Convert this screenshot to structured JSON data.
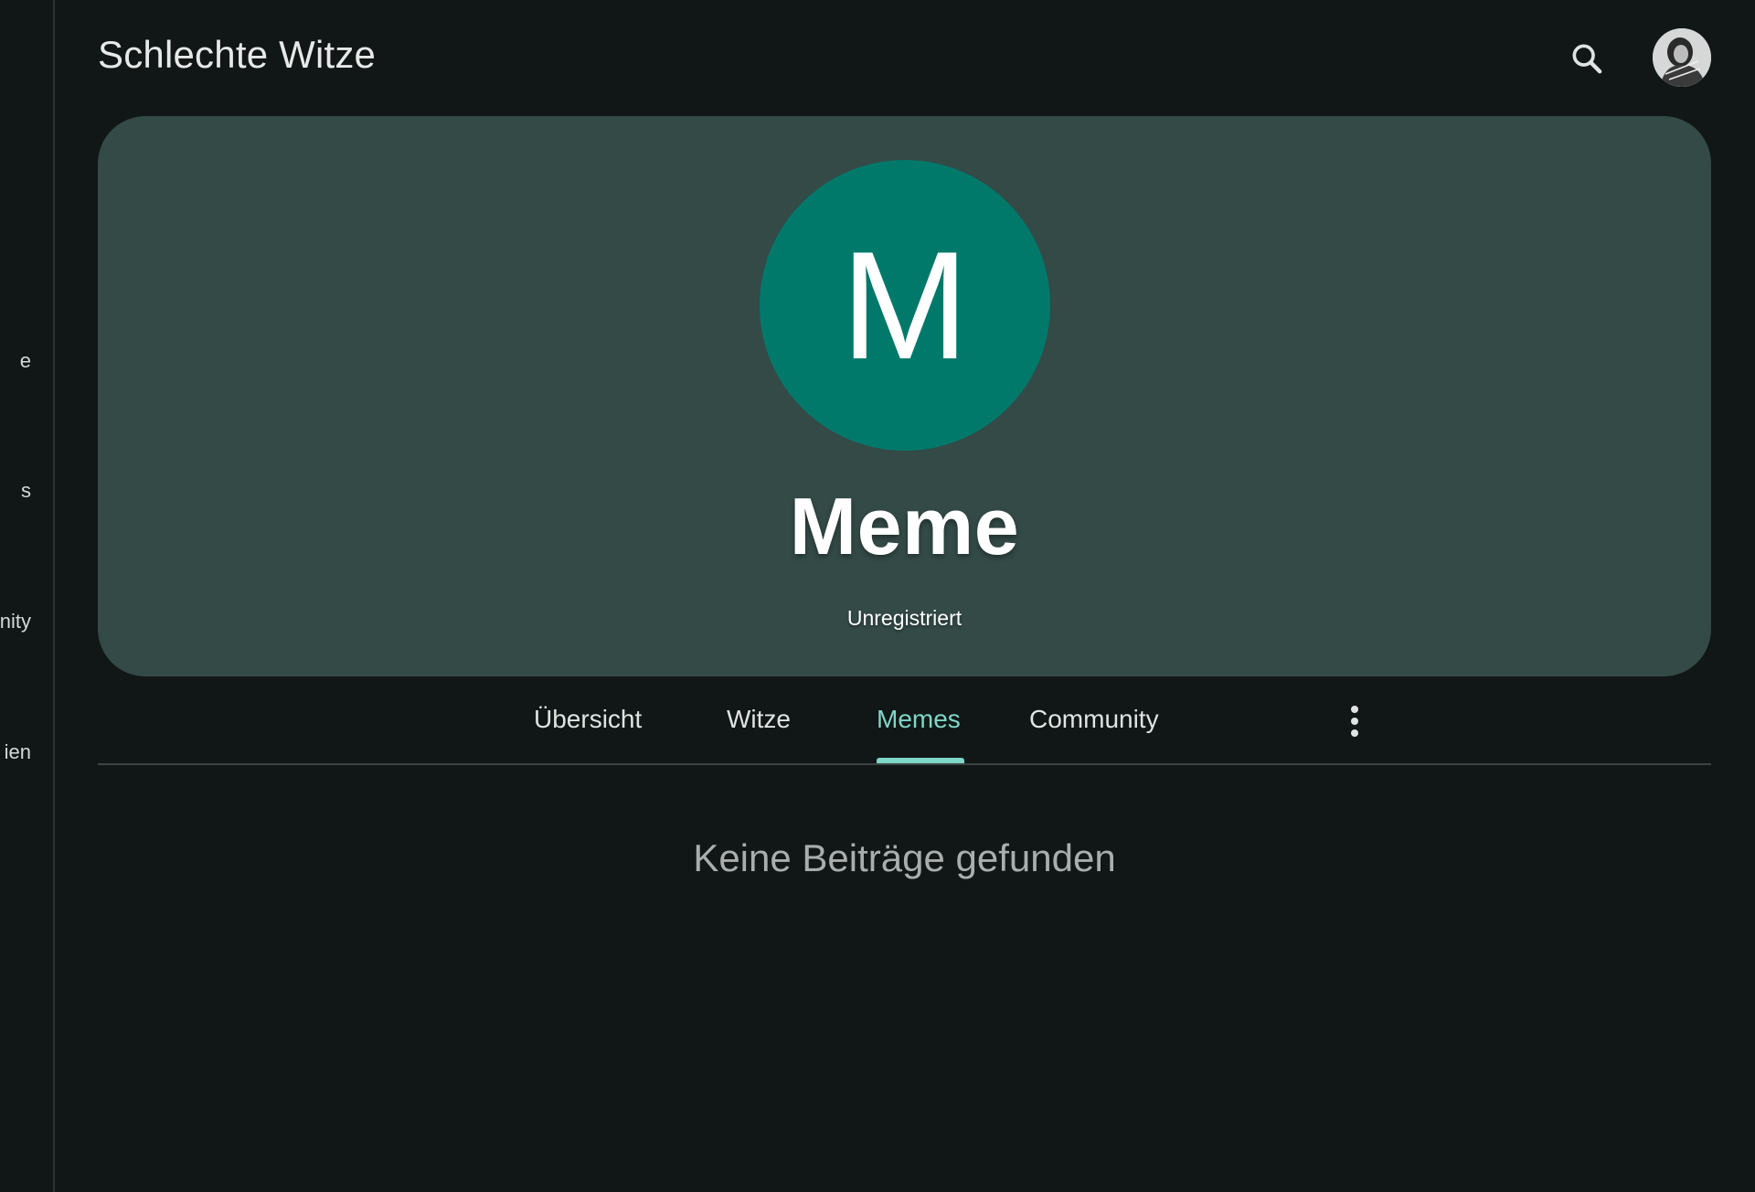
{
  "app": {
    "title": "Schlechte Witze"
  },
  "side_rail": {
    "items": [
      {
        "label": "e"
      },
      {
        "label": "s"
      },
      {
        "label": "nity"
      },
      {
        "label": "ien"
      }
    ]
  },
  "header": {
    "search_icon": "search-icon",
    "avatar_icon": "user-avatar"
  },
  "profile": {
    "initial": "M",
    "name": "Meme",
    "status": "Unregistriert",
    "avatar_color": "#00796b",
    "card_color": "#334a47"
  },
  "tabs": [
    {
      "label": "Übersicht",
      "active": false
    },
    {
      "label": "Witze",
      "active": false
    },
    {
      "label": "Memes",
      "active": true
    },
    {
      "label": "Community",
      "active": false
    }
  ],
  "tabs_more_icon": "more-vert-icon",
  "content": {
    "empty_message": "Keine Beiträge gefunden"
  },
  "colors": {
    "accent": "#7ed6c8",
    "background": "#111716"
  }
}
